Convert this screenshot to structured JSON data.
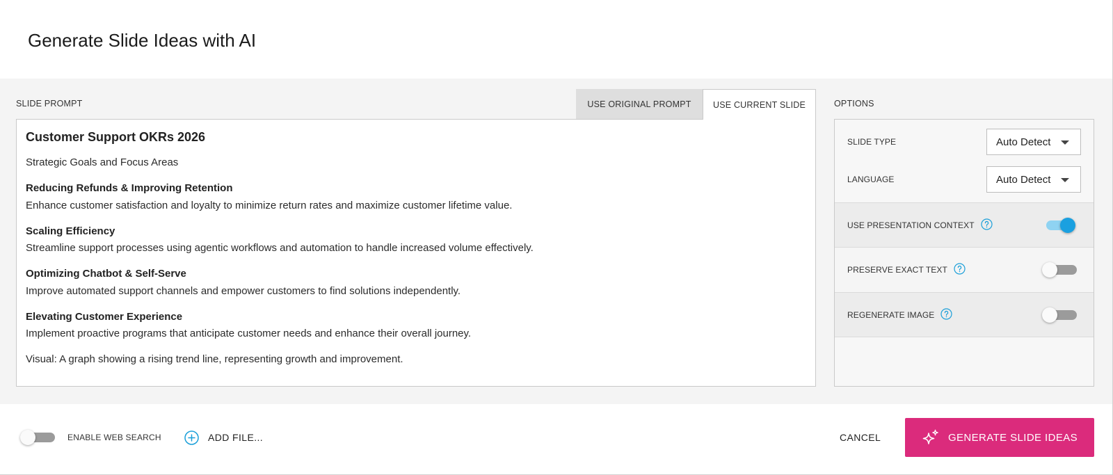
{
  "dialog": {
    "title": "Generate Slide Ideas with AI"
  },
  "prompt": {
    "label": "SLIDE PROMPT",
    "tabs": [
      {
        "label": "USE ORIGINAL PROMPT",
        "active": false
      },
      {
        "label": "USE CURRENT SLIDE",
        "active": true
      }
    ],
    "content": {
      "title": "Customer Support OKRs 2026",
      "subtitle": "Strategic Goals and Focus Areas",
      "sections": [
        {
          "heading": "Reducing Refunds & Improving Retention",
          "body": "Enhance customer satisfaction and loyalty to minimize return rates and maximize customer lifetime value."
        },
        {
          "heading": "Scaling Efficiency",
          "body": "Streamline support processes using agentic workflows and automation to handle increased volume effectively."
        },
        {
          "heading": "Optimizing Chatbot & Self-Serve",
          "body": "Improve automated support channels and empower customers to find solutions independently."
        },
        {
          "heading": "Elevating Customer Experience",
          "body": "Implement proactive programs that anticipate customer needs and enhance their overall journey."
        }
      ],
      "visual": "Visual: A graph showing a rising trend line, representing growth and improvement."
    }
  },
  "options": {
    "label": "OPTIONS",
    "slide_type": {
      "label": "SLIDE TYPE",
      "value": "Auto Detect",
      "icon": "caret-down-icon"
    },
    "language": {
      "label": "LANGUAGE",
      "value": "Auto Detect",
      "icon": "caret-down-icon"
    },
    "toggles": [
      {
        "label": "USE PRESENTATION CONTEXT",
        "on": true,
        "icon": "help-circle-icon"
      },
      {
        "label": "PRESERVE EXACT TEXT",
        "on": false,
        "icon": "help-circle-icon"
      },
      {
        "label": "REGENERATE IMAGE",
        "on": false,
        "icon": "help-circle-icon"
      }
    ]
  },
  "footer": {
    "web_search": {
      "label": "ENABLE WEB SEARCH",
      "on": false
    },
    "add_file": {
      "label": "ADD FILE...",
      "icon": "plus-circle-icon"
    },
    "cancel": {
      "label": "CANCEL"
    },
    "generate": {
      "label": "GENERATE SLIDE IDEAS",
      "icon": "sparkle-icon"
    }
  },
  "colors": {
    "accent": "#db2b7c",
    "toggle_on": "#1aa0e0",
    "toggle_on_track": "#8fd3f2",
    "help_icon": "#1a9fd9"
  }
}
